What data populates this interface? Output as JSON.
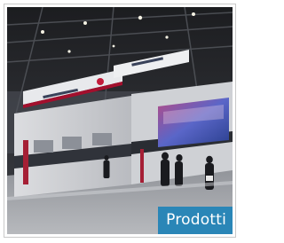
{
  "tile": {
    "caption": "Prodotti",
    "image_subject": "trade-show-exhibition-booth-photo",
    "caption_bg_color": "#2a86b7",
    "caption_text_color": "#ffffff",
    "border_color": "#c9c9c9"
  }
}
